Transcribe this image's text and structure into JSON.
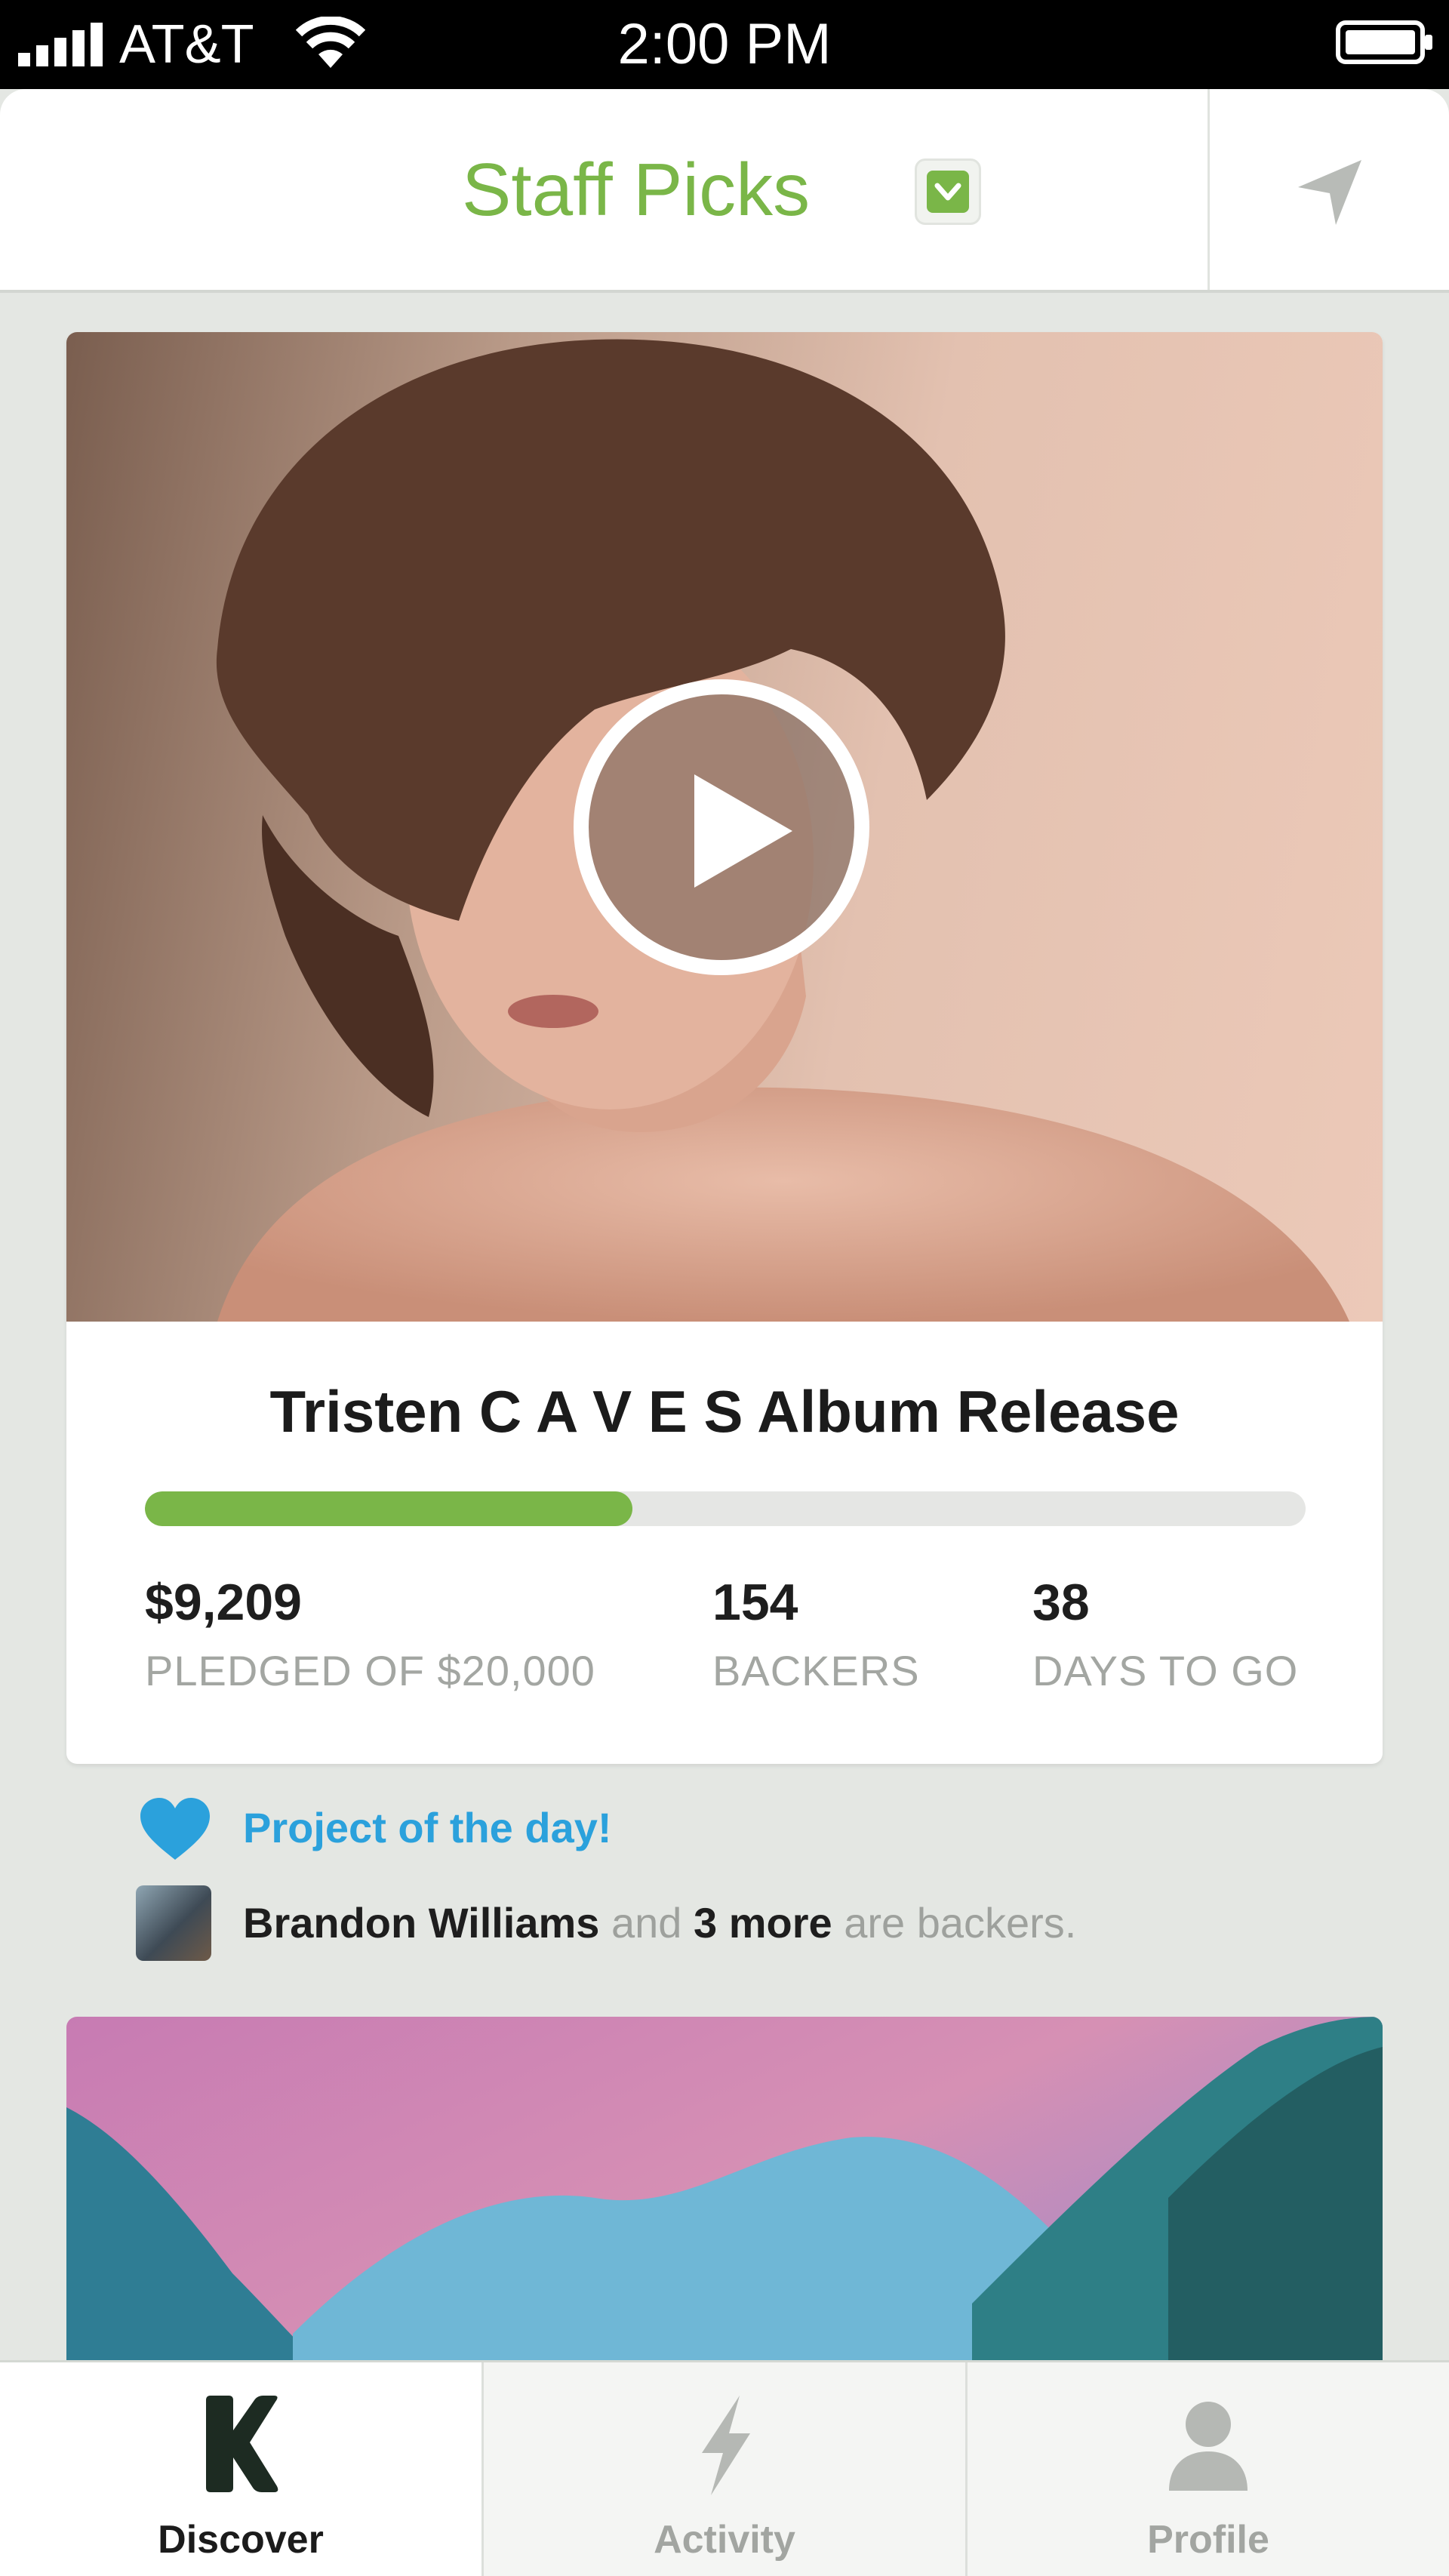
{
  "status_bar": {
    "carrier": "AT&T",
    "time": "2:00 PM"
  },
  "header": {
    "title": "Staff Picks",
    "accent_color": "#7ab648"
  },
  "project": {
    "title": "Tristen C A V E S Album Release",
    "funded_fraction": 0.42,
    "stats": {
      "pledged_value": "$9,209",
      "pledged_label": "PLEDGED OF $20,000",
      "backers_value": "154",
      "backers_label": "BACKERS",
      "days_value": "38",
      "days_label": "DAYS TO GO"
    }
  },
  "social": {
    "project_of_day": "Project of the day!",
    "backer_name": "Brandon Williams",
    "backer_connector": "and",
    "backer_more": "3 more",
    "backer_suffix": "are backers."
  },
  "tab_bar": {
    "tabs": [
      {
        "label": "Discover",
        "icon": "kickstarter-k-icon",
        "active": true
      },
      {
        "label": "Activity",
        "icon": "lightning-icon",
        "active": false
      },
      {
        "label": "Profile",
        "icon": "person-icon",
        "active": false
      }
    ]
  }
}
